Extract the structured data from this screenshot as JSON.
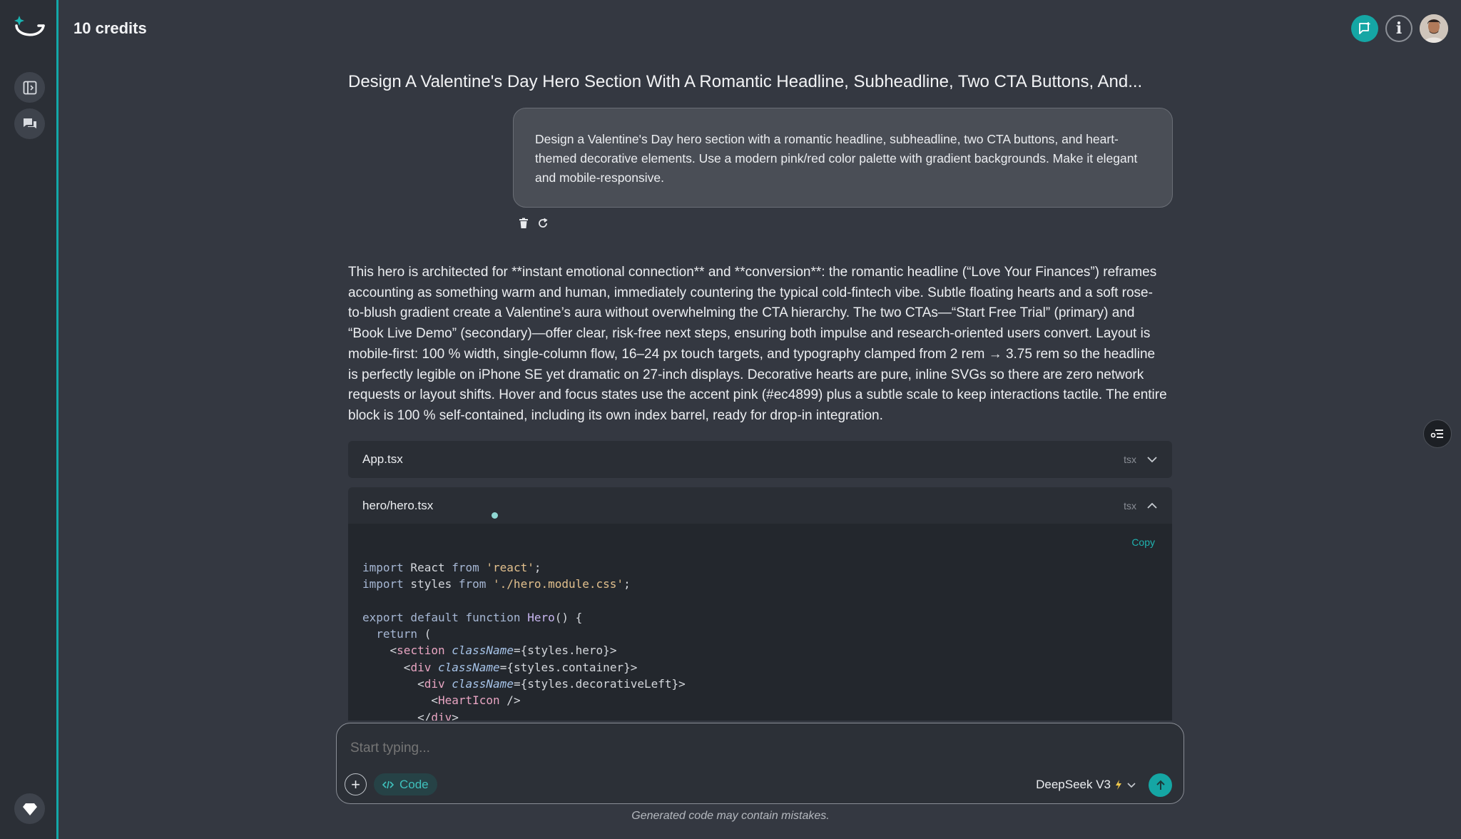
{
  "header": {
    "credits": "10 credits"
  },
  "chat": {
    "title": "Design A Valentine's Day Hero Section With A Romantic Headline, Subheadline, Two CTA Buttons, And...",
    "prompt": "Design a Valentine's Day hero section with a romantic headline, subheadline, two CTA buttons, and heart-themed decorative elements. Use a modern pink/red color palette with gradient backgrounds. Make it elegant and mobile-responsive.",
    "response": "This hero is architected for **instant emotional connection** and **conversion**: the romantic headline (“Love Your Finances”) reframes accounting as something warm and human, immediately countering the typical cold-fintech vibe. Subtle floating hearts and a soft rose-to-blush gradient create a Valentine’s aura without overwhelming the CTA hierarchy. The two CTAs—“Start Free Trial” (primary) and “Book Live Demo” (secondary)—offer clear, risk-free next steps, ensuring both impulse and research-oriented users convert. Layout is mobile-first: 100 % width, single-column flow, 16–24 px touch targets, and typography clamped from 2 rem → 3.75 rem so the headline is perfectly legible on iPhone SE yet dramatic on 27-inch displays. Decorative hearts are pure, inline SVGs so there are zero network requests or layout shifts. Hover and focus states use the accent pink (#ec4899) plus a subtle scale to keep interactions tactile. The entire block is 100 % self-contained, including its own index barrel, ready for drop-in integration."
  },
  "files": [
    {
      "name": "App.tsx",
      "ext": "tsx",
      "expanded": false
    },
    {
      "name": "hero/hero.tsx",
      "ext": "tsx",
      "expanded": true
    }
  ],
  "code": {
    "copy_label": "Copy",
    "lines": [
      "import React from 'react';",
      "import styles from './hero.module.css';",
      "",
      "export default function Hero() {",
      "  return (",
      "    <section className={styles.hero}>",
      "      <div className={styles.container}>",
      "        <div className={styles.decorativeLeft}>",
      "          <HeartIcon />",
      "        </div>"
    ]
  },
  "composer": {
    "placeholder": "Start typing...",
    "code_chip": "Code",
    "model": "DeepSeek V3",
    "disclaimer": "Generated code may contain mistakes."
  },
  "colors": {
    "accent": "#15a6a4",
    "background": "#343841",
    "sidebar": "#2b2f36"
  }
}
